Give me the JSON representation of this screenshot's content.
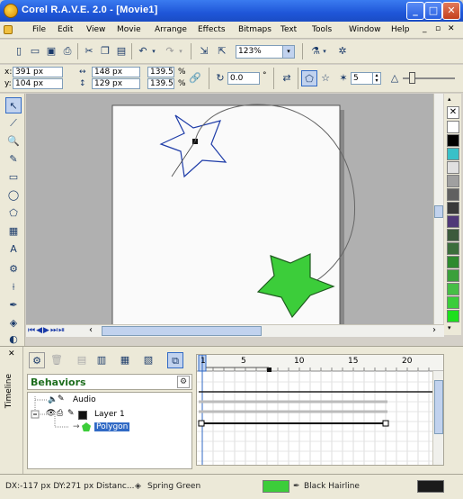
{
  "window": {
    "title": "Corel R.A.V.E. 2.0 - [Movie1]"
  },
  "menu": [
    "File",
    "Edit",
    "View",
    "Movie",
    "Arrange",
    "Effects",
    "Bitmaps",
    "Text",
    "Tools",
    "Window",
    "Help"
  ],
  "toolbar": {
    "zoom": "123%"
  },
  "props": {
    "x_label": "x:",
    "x": "391 px",
    "y_label": "y:",
    "y": "104 px",
    "w": "148 px",
    "h": "129 px",
    "sx": "139.5",
    "sy": "139.5",
    "pct": "%",
    "angle": "0.0",
    "deg": "°",
    "points": "5"
  },
  "palette": {
    "colors": [
      "#ffffff",
      "#000000",
      "#39c0c8",
      "#e0e0e0",
      "#a0a0a0",
      "#606060",
      "#3a3a3a",
      "#503878",
      "#3c5a3c",
      "#3c6e3c",
      "#2e8a2e",
      "#3aa03a",
      "#46be46",
      "#3acd3a",
      "#1ee01e"
    ]
  },
  "timeline": {
    "panel_title": "Timeline",
    "behaviors_label": "Behaviors",
    "tree": {
      "audio": "Audio",
      "layer": "Layer 1",
      "object": "Polygon"
    },
    "ruler": [
      "1",
      "5",
      "10",
      "15",
      "20"
    ]
  },
  "status": {
    "coords": "DX:-117 px DY:271 px Distanc...",
    "fill_name": "Spring Green",
    "fill_color": "#3ccd3a",
    "outline_name": "Black Hairline",
    "outline_color": "#1a1a1a"
  }
}
